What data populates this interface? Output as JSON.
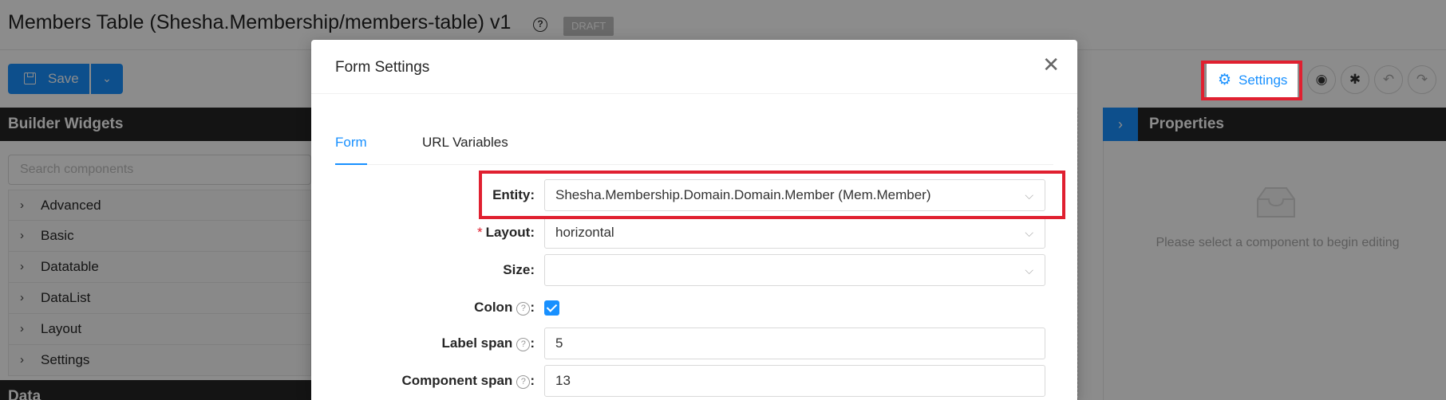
{
  "page": {
    "title": "Members Table (Shesha.Membership/members-table) v1",
    "help_icon": "?",
    "status_badge": "DRAFT"
  },
  "toolbar": {
    "save_label": "Save",
    "save_icon": "save-icon",
    "dropdown_icon": "chevron-down-icon",
    "settings_label": "Settings",
    "settings_icon": "gear-icon",
    "preview_icon": "eye-icon",
    "debug_icon": "bug-icon",
    "undo_icon": "undo-icon",
    "redo_icon": "redo-icon"
  },
  "builder_widgets": {
    "title": "Builder Widgets",
    "search_placeholder": "Search components",
    "groups": [
      {
        "label": "Advanced"
      },
      {
        "label": "Basic"
      },
      {
        "label": "Datatable"
      },
      {
        "label": "DataList"
      },
      {
        "label": "Layout"
      },
      {
        "label": "Settings"
      }
    ],
    "data_title": "Data"
  },
  "properties": {
    "title": "Properties",
    "empty_text": "Please select a component to begin editing"
  },
  "modal": {
    "title": "Form Settings",
    "close_symbol": "✕",
    "tabs": [
      {
        "label": "Form",
        "active": true
      },
      {
        "label": "URL Variables",
        "active": false
      }
    ],
    "fields": {
      "entity": {
        "label": "Entity",
        "value": "Shesha.Membership.Domain.Domain.Member (Mem.Member)"
      },
      "layout": {
        "label": "Layout",
        "value": "horizontal",
        "required": true
      },
      "size": {
        "label": "Size",
        "value": ""
      },
      "colon": {
        "label": "Colon",
        "checked": true
      },
      "label_span": {
        "label": "Label span",
        "value": "5"
      },
      "component_span": {
        "label": "Component span",
        "value": "13"
      }
    },
    "colon_char": ":"
  },
  "colors": {
    "primary": "#1890ff",
    "highlight": "#e02030",
    "dark_header": "#262626"
  }
}
